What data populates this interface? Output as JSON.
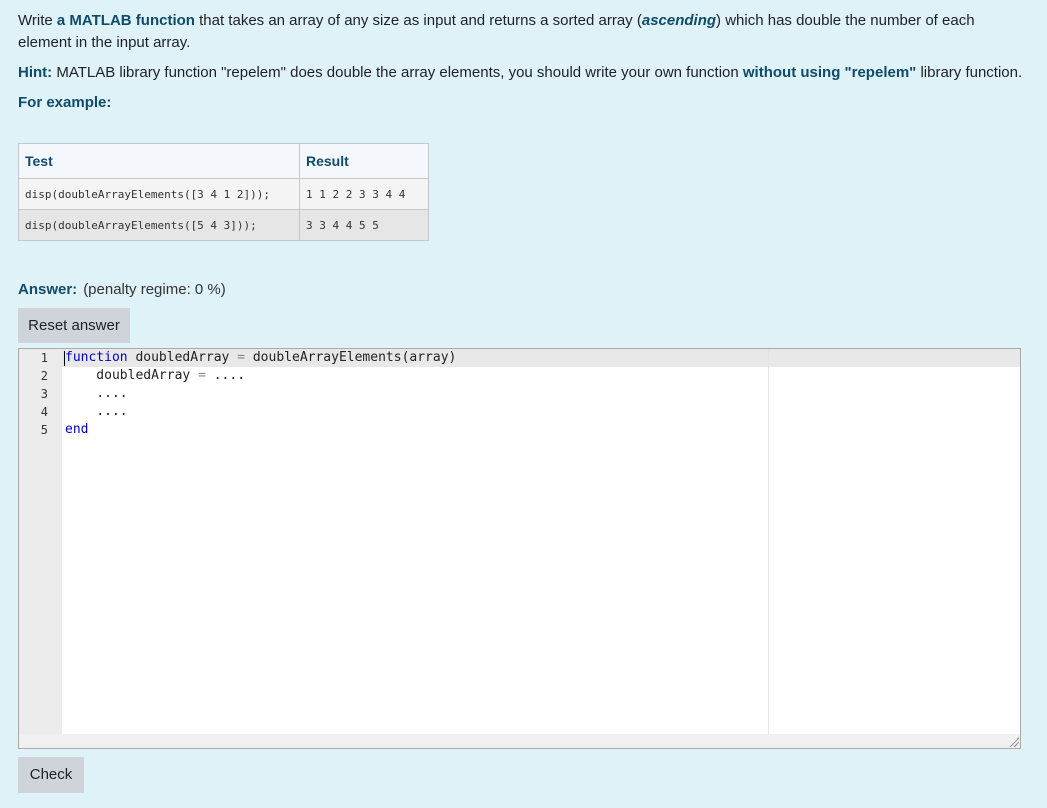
{
  "question": {
    "p1_prefix": "Write ",
    "p1_bold": "a MATLAB function",
    "p1_mid": " that takes an array of any size as input and returns a sorted array (",
    "p1_italic": "ascending",
    "p1_suffix": ") which has double the number of each element in the input array.",
    "hint_label": "Hint:",
    "hint_text": " MATLAB library function \"repelem\" does double the array elements, you should write your own function ",
    "hint_bold": "without using \"repelem\"",
    "hint_suffix": " library function.",
    "example_label": "For example:"
  },
  "examples": {
    "headers": [
      "Test",
      "Result"
    ],
    "rows": [
      {
        "test": "disp(doubleArrayElements([3 4 1 2]));",
        "result": "1 1 2 2 3 3 4 4"
      },
      {
        "test": "disp(doubleArrayElements([5 4 3]));",
        "result": "3 3 4 4 5 5"
      }
    ]
  },
  "answer": {
    "label": "Answer:",
    "penalty": "(penalty regime: 0 %)",
    "reset_label": "Reset answer",
    "check_label": "Check"
  },
  "editor": {
    "line_numbers": [
      "1",
      "2",
      "3",
      "4",
      "5"
    ],
    "line1_kw": "function",
    "line1_rest": " doubledArray ",
    "line1_op": "=",
    "line1_end": " doubleArrayElements(array)",
    "line2_a": "    doubledArray ",
    "line2_op": "=",
    "line2_b": " ....",
    "line3": "    ....",
    "line4": "    ....",
    "line5_kw": "end"
  }
}
